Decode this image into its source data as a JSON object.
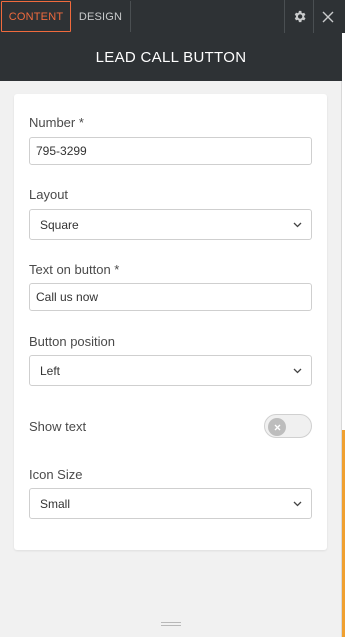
{
  "tabs": {
    "content": "CONTENT",
    "design": "DESIGN"
  },
  "icons": {
    "settings": "gear-icon",
    "close": "close-icon"
  },
  "header": {
    "title": "LEAD CALL BUTTON"
  },
  "form": {
    "number_label": "Number *",
    "number_value": "795-3299",
    "layout_label": "Layout",
    "layout_value": "Square",
    "text_label": "Text on button *",
    "text_value": "Call us now",
    "position_label": "Button position",
    "position_value": "Left",
    "show_text_label": "Show text",
    "show_text_enabled": false,
    "icon_size_label": "Icon Size",
    "icon_size_value": "Small"
  },
  "colors": {
    "accent": "#f06a3d",
    "topbar": "#2e3235",
    "panel_bg": "#f1f1f1"
  }
}
